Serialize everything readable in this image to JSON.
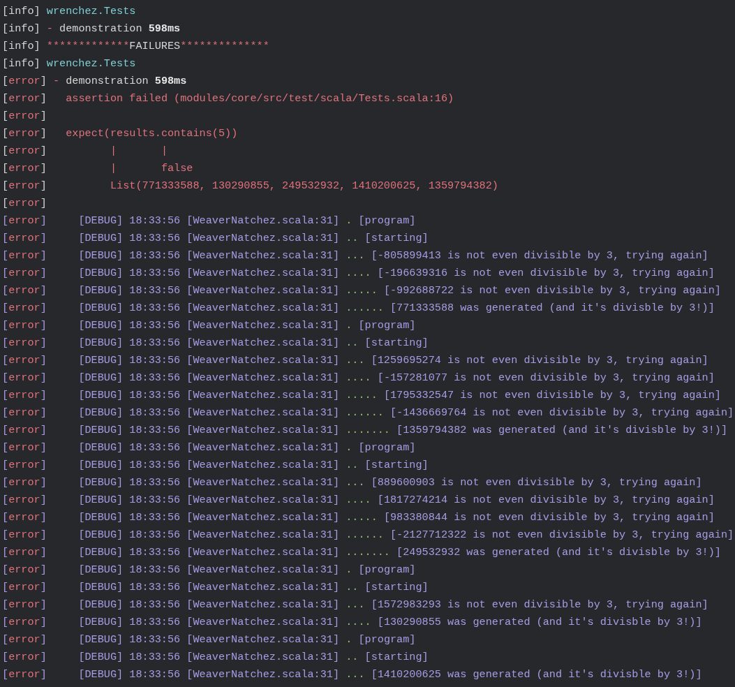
{
  "log_lines": [
    {
      "segments": [
        {
          "kind": "white",
          "text": "[info]"
        },
        {
          "kind": "cyan",
          "text": " wrenchez.Tests"
        }
      ]
    },
    {
      "segments": [
        {
          "kind": "white",
          "text": "[info]"
        },
        {
          "kind": "red",
          "text": " -"
        },
        {
          "kind": "white",
          "text": " demonstration "
        },
        {
          "kind": "bold",
          "text": "598ms"
        }
      ]
    },
    {
      "segments": [
        {
          "kind": "white",
          "text": "[info] "
        },
        {
          "kind": "red",
          "text": "*************"
        },
        {
          "kind": "white",
          "text": "FAILURES"
        },
        {
          "kind": "red",
          "text": "**************"
        }
      ]
    },
    {
      "segments": [
        {
          "kind": "white",
          "text": "[info]"
        },
        {
          "kind": "cyan",
          "text": " wrenchez.Tests"
        }
      ]
    },
    {
      "segments": [
        {
          "kind": "white",
          "text": "["
        },
        {
          "kind": "red",
          "text": "error"
        },
        {
          "kind": "white",
          "text": "]"
        },
        {
          "kind": "red",
          "text": " -"
        },
        {
          "kind": "white",
          "text": " demonstration "
        },
        {
          "kind": "bold",
          "text": "598ms"
        }
      ]
    },
    {
      "segments": [
        {
          "kind": "white",
          "text": "["
        },
        {
          "kind": "red",
          "text": "error"
        },
        {
          "kind": "white",
          "text": "]"
        },
        {
          "kind": "red",
          "text": "   assertion failed (modules/core/src/test/scala/Tests.scala:16)"
        }
      ]
    },
    {
      "segments": [
        {
          "kind": "white",
          "text": "["
        },
        {
          "kind": "red",
          "text": "error"
        },
        {
          "kind": "white",
          "text": "]"
        }
      ]
    },
    {
      "segments": [
        {
          "kind": "white",
          "text": "["
        },
        {
          "kind": "red",
          "text": "error"
        },
        {
          "kind": "white",
          "text": "]"
        },
        {
          "kind": "red",
          "text": "   expect(results.contains(5))"
        }
      ]
    },
    {
      "segments": [
        {
          "kind": "white",
          "text": "["
        },
        {
          "kind": "red",
          "text": "error"
        },
        {
          "kind": "white",
          "text": "]"
        },
        {
          "kind": "red",
          "text": "          |       |"
        }
      ]
    },
    {
      "segments": [
        {
          "kind": "white",
          "text": "["
        },
        {
          "kind": "red",
          "text": "error"
        },
        {
          "kind": "white",
          "text": "]"
        },
        {
          "kind": "red",
          "text": "          |       false"
        }
      ]
    },
    {
      "segments": [
        {
          "kind": "white",
          "text": "["
        },
        {
          "kind": "red",
          "text": "error"
        },
        {
          "kind": "white",
          "text": "]"
        },
        {
          "kind": "red",
          "text": "          List(771333588, 130290855, 249532932, 1410200625, 1359794382)"
        }
      ]
    },
    {
      "segments": [
        {
          "kind": "white",
          "text": "["
        },
        {
          "kind": "red",
          "text": "error"
        },
        {
          "kind": "white",
          "text": "]"
        }
      ]
    },
    {
      "segments": [
        {
          "kind": "purple",
          "text": "["
        },
        {
          "kind": "red",
          "text": "error"
        },
        {
          "kind": "purple",
          "text": "]     [DEBUG] 18:33:56 [WeaverNatchez.scala:31] "
        },
        {
          "kind": "green",
          "text": "."
        },
        {
          "kind": "purple",
          "text": " [program]"
        }
      ]
    },
    {
      "segments": [
        {
          "kind": "purple",
          "text": "["
        },
        {
          "kind": "red",
          "text": "error"
        },
        {
          "kind": "purple",
          "text": "]     [DEBUG] 18:33:56 [WeaverNatchez.scala:31] "
        },
        {
          "kind": "green",
          "text": ".."
        },
        {
          "kind": "purple",
          "text": " [starting]"
        }
      ]
    },
    {
      "segments": [
        {
          "kind": "purple",
          "text": "["
        },
        {
          "kind": "red",
          "text": "error"
        },
        {
          "kind": "purple",
          "text": "]     [DEBUG] 18:33:56 [WeaverNatchez.scala:31] "
        },
        {
          "kind": "green",
          "text": "..."
        },
        {
          "kind": "purple",
          "text": " [-805899413 is not even divisible by 3, trying again]"
        }
      ]
    },
    {
      "segments": [
        {
          "kind": "purple",
          "text": "["
        },
        {
          "kind": "red",
          "text": "error"
        },
        {
          "kind": "purple",
          "text": "]     [DEBUG] 18:33:56 [WeaverNatchez.scala:31] "
        },
        {
          "kind": "green",
          "text": "...."
        },
        {
          "kind": "purple",
          "text": " [-196639316 is not even divisible by 3, trying again]"
        }
      ]
    },
    {
      "segments": [
        {
          "kind": "purple",
          "text": "["
        },
        {
          "kind": "red",
          "text": "error"
        },
        {
          "kind": "purple",
          "text": "]     [DEBUG] 18:33:56 [WeaverNatchez.scala:31] "
        },
        {
          "kind": "green",
          "text": "....."
        },
        {
          "kind": "purple",
          "text": " [-992688722 is not even divisible by 3, trying again]"
        }
      ]
    },
    {
      "segments": [
        {
          "kind": "purple",
          "text": "["
        },
        {
          "kind": "red",
          "text": "error"
        },
        {
          "kind": "purple",
          "text": "]     [DEBUG] 18:33:56 [WeaverNatchez.scala:31] "
        },
        {
          "kind": "green",
          "text": "......"
        },
        {
          "kind": "purple",
          "text": " [771333588 was generated (and it's divisble by 3!)]"
        }
      ]
    },
    {
      "segments": [
        {
          "kind": "purple",
          "text": "["
        },
        {
          "kind": "red",
          "text": "error"
        },
        {
          "kind": "purple",
          "text": "]     [DEBUG] 18:33:56 [WeaverNatchez.scala:31] "
        },
        {
          "kind": "green",
          "text": "."
        },
        {
          "kind": "purple",
          "text": " [program]"
        }
      ]
    },
    {
      "segments": [
        {
          "kind": "purple",
          "text": "["
        },
        {
          "kind": "red",
          "text": "error"
        },
        {
          "kind": "purple",
          "text": "]     [DEBUG] 18:33:56 [WeaverNatchez.scala:31] "
        },
        {
          "kind": "green",
          "text": ".."
        },
        {
          "kind": "purple",
          "text": " [starting]"
        }
      ]
    },
    {
      "segments": [
        {
          "kind": "purple",
          "text": "["
        },
        {
          "kind": "red",
          "text": "error"
        },
        {
          "kind": "purple",
          "text": "]     [DEBUG] 18:33:56 [WeaverNatchez.scala:31] "
        },
        {
          "kind": "green",
          "text": "..."
        },
        {
          "kind": "purple",
          "text": " [1259695274 is not even divisible by 3, trying again]"
        }
      ]
    },
    {
      "segments": [
        {
          "kind": "purple",
          "text": "["
        },
        {
          "kind": "red",
          "text": "error"
        },
        {
          "kind": "purple",
          "text": "]     [DEBUG] 18:33:56 [WeaverNatchez.scala:31] "
        },
        {
          "kind": "green",
          "text": "...."
        },
        {
          "kind": "purple",
          "text": " [-157281077 is not even divisible by 3, trying again]"
        }
      ]
    },
    {
      "segments": [
        {
          "kind": "purple",
          "text": "["
        },
        {
          "kind": "red",
          "text": "error"
        },
        {
          "kind": "purple",
          "text": "]     [DEBUG] 18:33:56 [WeaverNatchez.scala:31] "
        },
        {
          "kind": "green",
          "text": "....."
        },
        {
          "kind": "purple",
          "text": " [1795332547 is not even divisible by 3, trying again]"
        }
      ]
    },
    {
      "segments": [
        {
          "kind": "purple",
          "text": "["
        },
        {
          "kind": "red",
          "text": "error"
        },
        {
          "kind": "purple",
          "text": "]     [DEBUG] 18:33:56 [WeaverNatchez.scala:31] "
        },
        {
          "kind": "green",
          "text": "......"
        },
        {
          "kind": "purple",
          "text": " [-1436669764 is not even divisible by 3, trying again]"
        }
      ]
    },
    {
      "segments": [
        {
          "kind": "purple",
          "text": "["
        },
        {
          "kind": "red",
          "text": "error"
        },
        {
          "kind": "purple",
          "text": "]     [DEBUG] 18:33:56 [WeaverNatchez.scala:31] "
        },
        {
          "kind": "green",
          "text": "......."
        },
        {
          "kind": "purple",
          "text": " [1359794382 was generated (and it's divisble by 3!)]"
        }
      ]
    },
    {
      "segments": [
        {
          "kind": "purple",
          "text": "["
        },
        {
          "kind": "red",
          "text": "error"
        },
        {
          "kind": "purple",
          "text": "]     [DEBUG] 18:33:56 [WeaverNatchez.scala:31] "
        },
        {
          "kind": "green",
          "text": "."
        },
        {
          "kind": "purple",
          "text": " [program]"
        }
      ]
    },
    {
      "segments": [
        {
          "kind": "purple",
          "text": "["
        },
        {
          "kind": "red",
          "text": "error"
        },
        {
          "kind": "purple",
          "text": "]     [DEBUG] 18:33:56 [WeaverNatchez.scala:31] "
        },
        {
          "kind": "green",
          "text": ".."
        },
        {
          "kind": "purple",
          "text": " [starting]"
        }
      ]
    },
    {
      "segments": [
        {
          "kind": "purple",
          "text": "["
        },
        {
          "kind": "red",
          "text": "error"
        },
        {
          "kind": "purple",
          "text": "]     [DEBUG] 18:33:56 [WeaverNatchez.scala:31] "
        },
        {
          "kind": "green",
          "text": "..."
        },
        {
          "kind": "purple",
          "text": " [889600903 is not even divisible by 3, trying again]"
        }
      ]
    },
    {
      "segments": [
        {
          "kind": "purple",
          "text": "["
        },
        {
          "kind": "red",
          "text": "error"
        },
        {
          "kind": "purple",
          "text": "]     [DEBUG] 18:33:56 [WeaverNatchez.scala:31] "
        },
        {
          "kind": "green",
          "text": "...."
        },
        {
          "kind": "purple",
          "text": " [1817274214 is not even divisible by 3, trying again]"
        }
      ]
    },
    {
      "segments": [
        {
          "kind": "purple",
          "text": "["
        },
        {
          "kind": "red",
          "text": "error"
        },
        {
          "kind": "purple",
          "text": "]     [DEBUG] 18:33:56 [WeaverNatchez.scala:31] "
        },
        {
          "kind": "green",
          "text": "....."
        },
        {
          "kind": "purple",
          "text": " [983380844 is not even divisible by 3, trying again]"
        }
      ]
    },
    {
      "segments": [
        {
          "kind": "purple",
          "text": "["
        },
        {
          "kind": "red",
          "text": "error"
        },
        {
          "kind": "purple",
          "text": "]     [DEBUG] 18:33:56 [WeaverNatchez.scala:31] "
        },
        {
          "kind": "green",
          "text": "......"
        },
        {
          "kind": "purple",
          "text": " [-2127712322 is not even divisible by 3, trying again]"
        }
      ]
    },
    {
      "segments": [
        {
          "kind": "purple",
          "text": "["
        },
        {
          "kind": "red",
          "text": "error"
        },
        {
          "kind": "purple",
          "text": "]     [DEBUG] 18:33:56 [WeaverNatchez.scala:31] "
        },
        {
          "kind": "green",
          "text": "......."
        },
        {
          "kind": "purple",
          "text": " [249532932 was generated (and it's divisble by 3!)]"
        }
      ]
    },
    {
      "segments": [
        {
          "kind": "purple",
          "text": "["
        },
        {
          "kind": "red",
          "text": "error"
        },
        {
          "kind": "purple",
          "text": "]     [DEBUG] 18:33:56 [WeaverNatchez.scala:31] "
        },
        {
          "kind": "green",
          "text": "."
        },
        {
          "kind": "purple",
          "text": " [program]"
        }
      ]
    },
    {
      "segments": [
        {
          "kind": "purple",
          "text": "["
        },
        {
          "kind": "red",
          "text": "error"
        },
        {
          "kind": "purple",
          "text": "]     [DEBUG] 18:33:56 [WeaverNatchez.scala:31] "
        },
        {
          "kind": "green",
          "text": ".."
        },
        {
          "kind": "purple",
          "text": " [starting]"
        }
      ]
    },
    {
      "segments": [
        {
          "kind": "purple",
          "text": "["
        },
        {
          "kind": "red",
          "text": "error"
        },
        {
          "kind": "purple",
          "text": "]     [DEBUG] 18:33:56 [WeaverNatchez.scala:31] "
        },
        {
          "kind": "green",
          "text": "..."
        },
        {
          "kind": "purple",
          "text": " [1572983293 is not even divisible by 3, trying again]"
        }
      ]
    },
    {
      "segments": [
        {
          "kind": "purple",
          "text": "["
        },
        {
          "kind": "red",
          "text": "error"
        },
        {
          "kind": "purple",
          "text": "]     [DEBUG] 18:33:56 [WeaverNatchez.scala:31] "
        },
        {
          "kind": "green",
          "text": "...."
        },
        {
          "kind": "purple",
          "text": " [130290855 was generated (and it's divisble by 3!)]"
        }
      ]
    },
    {
      "segments": [
        {
          "kind": "purple",
          "text": "["
        },
        {
          "kind": "red",
          "text": "error"
        },
        {
          "kind": "purple",
          "text": "]     [DEBUG] 18:33:56 [WeaverNatchez.scala:31] "
        },
        {
          "kind": "green",
          "text": "."
        },
        {
          "kind": "purple",
          "text": " [program]"
        }
      ]
    },
    {
      "segments": [
        {
          "kind": "purple",
          "text": "["
        },
        {
          "kind": "red",
          "text": "error"
        },
        {
          "kind": "purple",
          "text": "]     [DEBUG] 18:33:56 [WeaverNatchez.scala:31] "
        },
        {
          "kind": "green",
          "text": ".."
        },
        {
          "kind": "purple",
          "text": " [starting]"
        }
      ]
    },
    {
      "segments": [
        {
          "kind": "purple",
          "text": "["
        },
        {
          "kind": "red",
          "text": "error"
        },
        {
          "kind": "purple",
          "text": "]     [DEBUG] 18:33:56 [WeaverNatchez.scala:31] "
        },
        {
          "kind": "green",
          "text": "..."
        },
        {
          "kind": "purple",
          "text": " [1410200625 was generated (and it's divisble by 3!)]"
        }
      ]
    }
  ]
}
